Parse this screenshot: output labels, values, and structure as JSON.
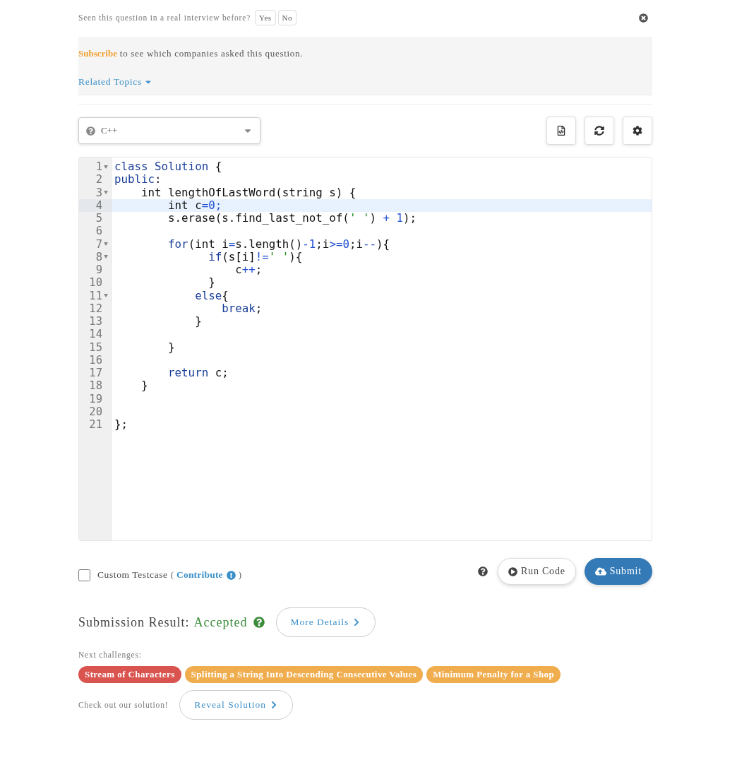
{
  "interview_prompt": {
    "question": "Seen this question in a real interview before?",
    "answers": [
      "Yes",
      "No"
    ]
  },
  "companies_panel": {
    "link": "Subscribe",
    "text": " to see which companies asked this question.",
    "related_topics": "Related Topics"
  },
  "language_select": {
    "value": "C++"
  },
  "editor": {
    "lines": [
      {
        "number": "1",
        "fold": true,
        "active": false,
        "tokens": [
          {
            "kind": "kw",
            "text": "class Solution"
          },
          {
            "kind": "plain",
            "text": " {"
          }
        ]
      },
      {
        "number": "2",
        "fold": false,
        "active": false,
        "tokens": [
          {
            "kind": "kw",
            "text": "public"
          },
          {
            "kind": "plain",
            "text": ":"
          }
        ]
      },
      {
        "number": "3",
        "fold": true,
        "active": false,
        "tokens": [
          {
            "kind": "plain",
            "text": "    int lengthOfLastWord(string s) {"
          }
        ]
      },
      {
        "number": "4",
        "fold": false,
        "active": true,
        "tokens": [
          {
            "kind": "plain",
            "text": "        int c"
          },
          {
            "kind": "op",
            "text": "="
          },
          {
            "kind": "num",
            "text": "0"
          },
          {
            "kind": "op",
            "text": ";"
          }
        ]
      },
      {
        "number": "5",
        "fold": false,
        "active": false,
        "tokens": [
          {
            "kind": "plain",
            "text": "        s.erase(s.find_last_not_of("
          },
          {
            "kind": "str",
            "text": "' '"
          },
          {
            "kind": "plain",
            "text": ")"
          },
          {
            "kind": "op",
            "text": " + "
          },
          {
            "kind": "num",
            "text": "1"
          },
          {
            "kind": "plain",
            "text": ");"
          }
        ]
      },
      {
        "number": "6",
        "fold": false,
        "active": false
      },
      {
        "number": "7",
        "fold": true,
        "active": false,
        "tokens": [
          {
            "kind": "kw",
            "text": "        for"
          },
          {
            "kind": "plain",
            "text": "(int i"
          },
          {
            "kind": "op",
            "text": "="
          },
          {
            "kind": "plain",
            "text": "s.length()"
          },
          {
            "kind": "op",
            "text": "-"
          },
          {
            "kind": "num",
            "text": "1"
          },
          {
            "kind": "plain",
            "text": ";i"
          },
          {
            "kind": "op",
            "text": ">="
          },
          {
            "kind": "num",
            "text": "0"
          },
          {
            "kind": "plain",
            "text": ";i"
          },
          {
            "kind": "op",
            "text": "--"
          },
          {
            "kind": "plain",
            "text": "){"
          }
        ]
      },
      {
        "number": "8",
        "fold": true,
        "active": false,
        "tokens": [
          {
            "kind": "kw",
            "text": "              if"
          },
          {
            "kind": "plain",
            "text": "(s[i]"
          },
          {
            "kind": "op",
            "text": "!="
          },
          {
            "kind": "str",
            "text": "' '"
          },
          {
            "kind": "plain",
            "text": "){"
          }
        ]
      },
      {
        "number": "9",
        "fold": false,
        "active": false,
        "tokens": [
          {
            "kind": "plain",
            "text": "                  c"
          },
          {
            "kind": "op",
            "text": "++"
          },
          {
            "kind": "plain",
            "text": ";"
          }
        ]
      },
      {
        "number": "10",
        "fold": false,
        "active": false,
        "tokens": [
          {
            "kind": "plain",
            "text": "              }"
          }
        ]
      },
      {
        "number": "11",
        "fold": true,
        "active": false,
        "tokens": [
          {
            "kind": "kw",
            "text": "            else"
          },
          {
            "kind": "plain",
            "text": "{"
          }
        ]
      },
      {
        "number": "12",
        "fold": false,
        "active": false,
        "tokens": [
          {
            "kind": "kw",
            "text": "                break"
          },
          {
            "kind": "plain",
            "text": ";"
          }
        ]
      },
      {
        "number": "13",
        "fold": false,
        "active": false,
        "tokens": [
          {
            "kind": "plain",
            "text": "            }"
          }
        ]
      },
      {
        "number": "14",
        "fold": false,
        "active": false
      },
      {
        "number": "15",
        "fold": false,
        "active": false,
        "tokens": [
          {
            "kind": "plain",
            "text": "        }"
          }
        ]
      },
      {
        "number": "16",
        "fold": false,
        "active": false
      },
      {
        "number": "17",
        "fold": false,
        "active": false,
        "tokens": [
          {
            "kind": "kw",
            "text": "        return"
          },
          {
            "kind": "plain",
            "text": " c;"
          }
        ]
      },
      {
        "number": "18",
        "fold": false,
        "active": false,
        "tokens": [
          {
            "kind": "plain",
            "text": "    }"
          }
        ]
      },
      {
        "number": "19",
        "fold": false,
        "active": false
      },
      {
        "number": "20",
        "fold": false,
        "active": false
      },
      {
        "number": "21",
        "fold": false,
        "active": false,
        "tokens": [
          {
            "kind": "plain",
            "text": "};"
          }
        ]
      }
    ]
  },
  "testcase": {
    "checked": false,
    "label": "Custom Testcase",
    "open_paren": "(",
    "link": "Contribute",
    "close_paren": ")"
  },
  "actions": {
    "run": "Run Code",
    "submit": "Submit"
  },
  "result": {
    "label": "Submission Result:",
    "status": "Accepted",
    "details": "More Details"
  },
  "next_challenges": {
    "label": "Next challenges:",
    "items": [
      {
        "title": "Stream of Characters",
        "color": "#d9534f"
      },
      {
        "title": "Splitting a String Into Descending Consecutive Values",
        "color": "#f0ad4e"
      },
      {
        "title": "Minimum Penalty for a Shop",
        "color": "#f0ad4e"
      }
    ]
  },
  "solution": {
    "label": "Check out our solution!",
    "button": "Reveal Solution"
  }
}
